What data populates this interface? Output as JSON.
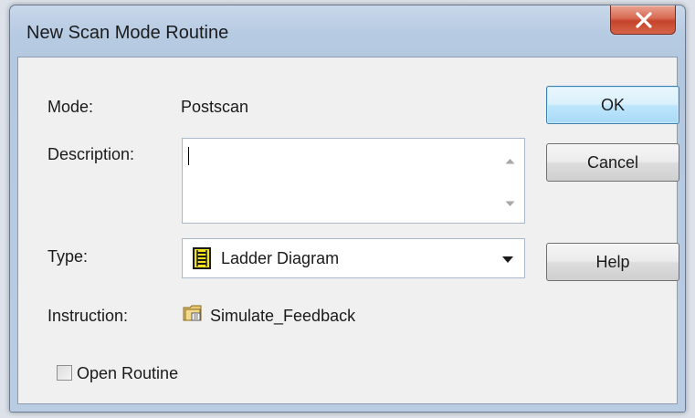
{
  "dialog": {
    "title": "New Scan Mode Routine",
    "close_icon": "close-x-icon"
  },
  "form": {
    "mode_label": "Mode:",
    "mode_value": "Postscan",
    "description_label": "Description:",
    "description_value": "",
    "type_label": "Type:",
    "type_value": "Ladder Diagram",
    "type_icon": "ladder-diagram-icon",
    "instruction_label": "Instruction:",
    "instruction_value": "Simulate_Feedback",
    "instruction_icon": "add-on-instruction-folder-icon",
    "open_routine_label": "Open Routine",
    "open_routine_checked": false
  },
  "buttons": {
    "ok": "OK",
    "cancel": "Cancel",
    "help": "Help"
  },
  "colors": {
    "close_button": "#c4432b",
    "default_button_border": "#3c7fb1",
    "titlebar": "#b9cce2"
  }
}
